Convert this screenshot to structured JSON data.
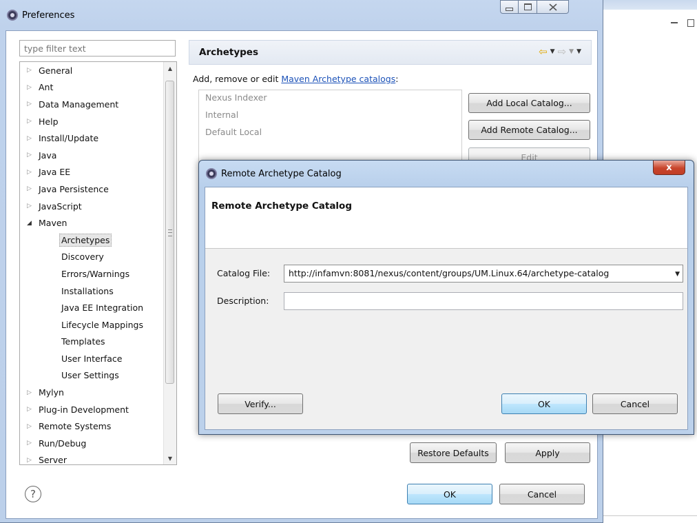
{
  "preferences": {
    "title": "Preferences",
    "filter_placeholder": "type filter text",
    "tree": [
      {
        "label": "General",
        "expanded": false
      },
      {
        "label": "Ant",
        "expanded": false
      },
      {
        "label": "Data Management",
        "expanded": false
      },
      {
        "label": "Help",
        "expanded": false
      },
      {
        "label": "Install/Update",
        "expanded": false
      },
      {
        "label": "Java",
        "expanded": false
      },
      {
        "label": "Java EE",
        "expanded": false
      },
      {
        "label": "Java Persistence",
        "expanded": false
      },
      {
        "label": "JavaScript",
        "expanded": false
      },
      {
        "label": "Maven",
        "expanded": true,
        "children": [
          "Archetypes",
          "Discovery",
          "Errors/Warnings",
          "Installations",
          "Java EE Integration",
          "Lifecycle Mappings",
          "Templates",
          "User Interface",
          "User Settings"
        ]
      },
      {
        "label": "Mylyn",
        "expanded": false
      },
      {
        "label": "Plug-in Development",
        "expanded": false
      },
      {
        "label": "Remote Systems",
        "expanded": false
      },
      {
        "label": "Run/Debug",
        "expanded": false
      },
      {
        "label": "Server",
        "expanded": false
      }
    ],
    "selected_item": "Archetypes",
    "page_title": "Archetypes",
    "intro_text": "Add, remove or edit ",
    "intro_link": "Maven Archetype catalogs",
    "intro_suffix": ":",
    "catalogs": [
      "Nexus Indexer",
      "Internal",
      "Default Local"
    ],
    "buttons": {
      "add_local": "Add Local Catalog...",
      "add_remote": "Add Remote Catalog...",
      "edit": "Edit",
      "restore_defaults": "Restore Defaults",
      "apply": "Apply",
      "ok": "OK",
      "cancel": "Cancel"
    },
    "help_glyph": "?"
  },
  "dialog": {
    "title": "Remote Archetype Catalog",
    "banner_title": "Remote Archetype Catalog",
    "catalog_file_label": "Catalog File:",
    "catalog_file_value": "http://infamvn:8081/nexus/content/groups/UM.Linux.64/archetype-catalog",
    "description_label": "Description:",
    "description_value": "",
    "buttons": {
      "verify": "Verify...",
      "ok": "OK",
      "cancel": "Cancel"
    },
    "close_glyph": "x"
  },
  "icons": {
    "window_icon": "eclipse-icon",
    "nav_back": "back-arrow-icon",
    "nav_forward": "forward-arrow-icon"
  },
  "colors": {
    "link": "#1c52b8",
    "nav_back": "#e0a800",
    "close_button": "#c8452c",
    "default_button": "#3c7fb1"
  }
}
